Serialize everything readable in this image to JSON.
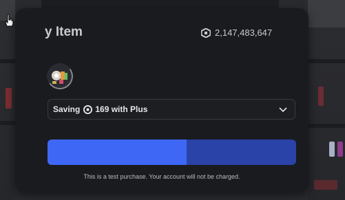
{
  "dialog": {
    "title": "y Item",
    "balance": "2,147,483,647",
    "balance_icon": "robux-icon",
    "thumbnail_icon": "item-thumbnail"
  },
  "savings": {
    "prefix": "Saving",
    "amount": "169 with Plus",
    "icon": "robux-icon",
    "chevron": "chevron-down-icon"
  },
  "purchase": {
    "progress": 0.56,
    "fill_color": "#3e67f6",
    "track_color": "#2a43a8"
  },
  "notice": "This is a test purchase. Your account will not be charged.",
  "colors": {
    "modal_bg": "#191b1f",
    "text": "#c9cbd0"
  }
}
